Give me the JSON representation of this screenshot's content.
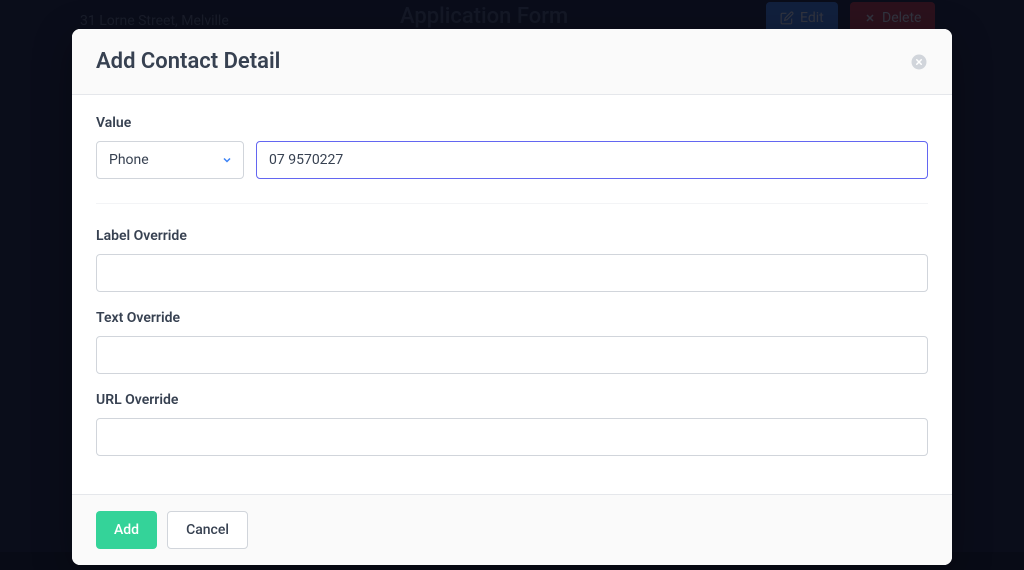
{
  "background": {
    "address": "31 Lorne Street, Melville",
    "title": "Application Form",
    "edit_label": "Edit",
    "delete_label": "Delete"
  },
  "modal": {
    "title": "Add Contact Detail",
    "value_label": "Value",
    "type_selected": "Phone",
    "value_input": "07 9570227",
    "label_override_label": "Label Override",
    "label_override_value": "",
    "text_override_label": "Text Override",
    "text_override_value": "",
    "url_override_label": "URL Override",
    "url_override_value": "",
    "add_button": "Add",
    "cancel_button": "Cancel"
  }
}
